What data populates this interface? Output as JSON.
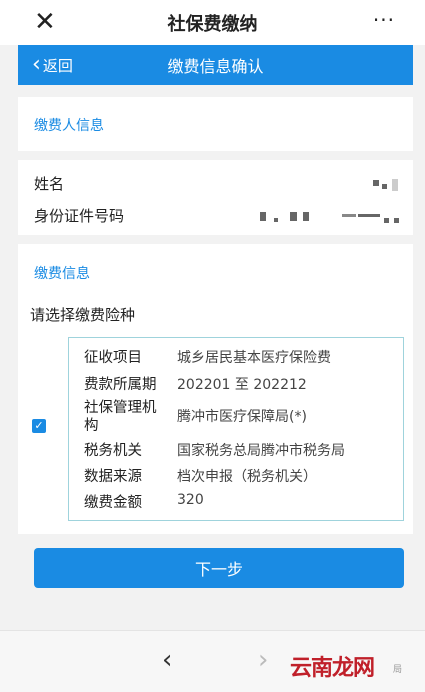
{
  "app": {
    "title": "社保费缴纳",
    "more": "···",
    "close": "✕"
  },
  "nav": {
    "back_label": "返回",
    "title": "缴费信息确认"
  },
  "payer": {
    "section_title": "缴费人信息",
    "name_label": "姓名",
    "id_label": "身份证件号码"
  },
  "payment": {
    "section_title": "缴费信息",
    "choose_label": "请选择缴费险种",
    "checkbox_checked": true,
    "details": [
      {
        "label": "征收项目",
        "value": "城乡居民基本医疗保险费"
      },
      {
        "label": "费款所属期",
        "value": "202201 至 202212"
      },
      {
        "label": "社保管理机构",
        "value": "腾冲市医疗保障局(*)"
      },
      {
        "label": "税务机关",
        "value": "国家税务总局腾冲市税务局"
      },
      {
        "label": "数据来源",
        "value": "档次申报（税务机关）"
      },
      {
        "label": "缴费金额",
        "value": "320"
      }
    ]
  },
  "actions": {
    "next_label": "下一步"
  },
  "bottom": {
    "back_arrow": "‹",
    "forward_arrow": "›"
  },
  "watermark": {
    "text": "云南龙网",
    "small": "局"
  },
  "colors": {
    "accent": "#1a8be3",
    "box_border": "#9fd3dc"
  }
}
